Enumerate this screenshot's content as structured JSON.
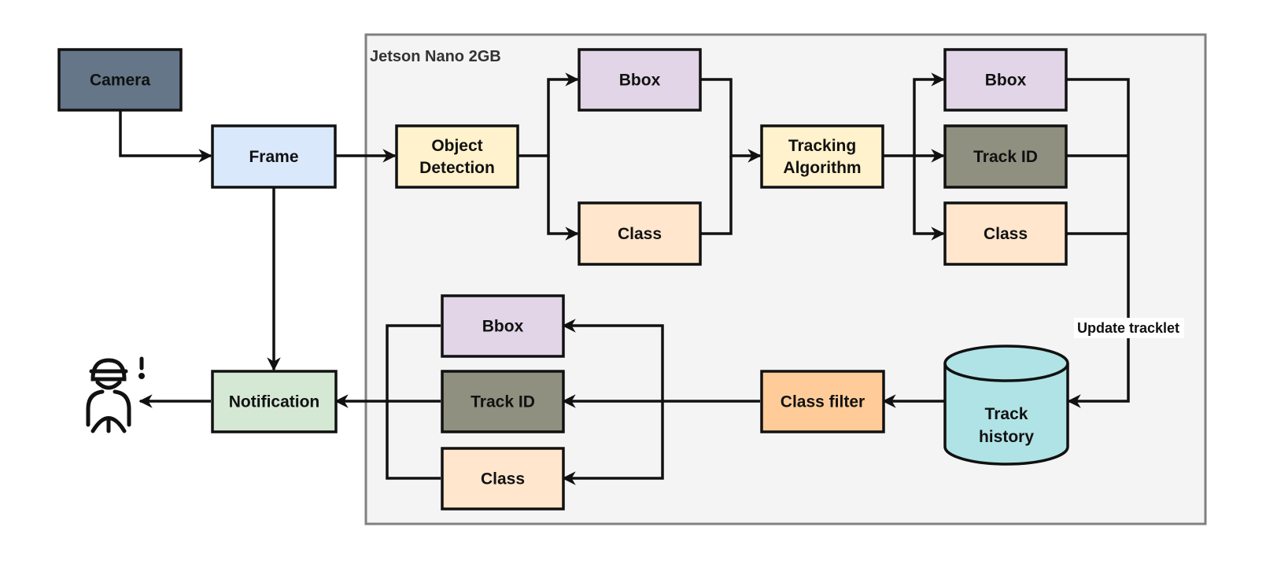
{
  "container": {
    "label": "Jetson Nano 2GB",
    "fill": "#f4f4f4",
    "stroke": "#808080"
  },
  "nodes": {
    "camera": {
      "label": [
        "Camera"
      ],
      "fill": "#647687"
    },
    "frame": {
      "label": [
        "Frame"
      ],
      "fill": "#dae8fc"
    },
    "object_detection": {
      "label": [
        "Object",
        "Detection"
      ],
      "fill": "#fff2cc"
    },
    "bbox1": {
      "label": [
        "Bbox"
      ],
      "fill": "#e1d5e7"
    },
    "class1": {
      "label": [
        "Class"
      ],
      "fill": "#ffe6cc"
    },
    "tracking": {
      "label": [
        "Tracking",
        "Algorithm"
      ],
      "fill": "#fff2cc"
    },
    "bbox2": {
      "label": [
        "Bbox"
      ],
      "fill": "#e1d5e7"
    },
    "trackid2": {
      "label": [
        "Track ID"
      ],
      "fill": "#8f9080"
    },
    "class2": {
      "label": [
        "Class"
      ],
      "fill": "#ffe6cc"
    },
    "track_history": {
      "label": [
        "Track",
        "history"
      ],
      "fill": "#b0e3e6"
    },
    "class_filter": {
      "label": [
        "Class filter"
      ],
      "fill": "#ffcc99"
    },
    "bbox3": {
      "label": [
        "Bbox"
      ],
      "fill": "#e1d5e7"
    },
    "trackid3": {
      "label": [
        "Track ID"
      ],
      "fill": "#8f9080"
    },
    "class3": {
      "label": [
        "Class"
      ],
      "fill": "#ffe6cc"
    },
    "notification": {
      "label": [
        "Notification"
      ],
      "fill": "#d5e8d4"
    }
  },
  "edge_labels": {
    "update_tracklet": "Update tracklet"
  },
  "icons": {
    "driver_alert": "driver-alert-icon"
  }
}
